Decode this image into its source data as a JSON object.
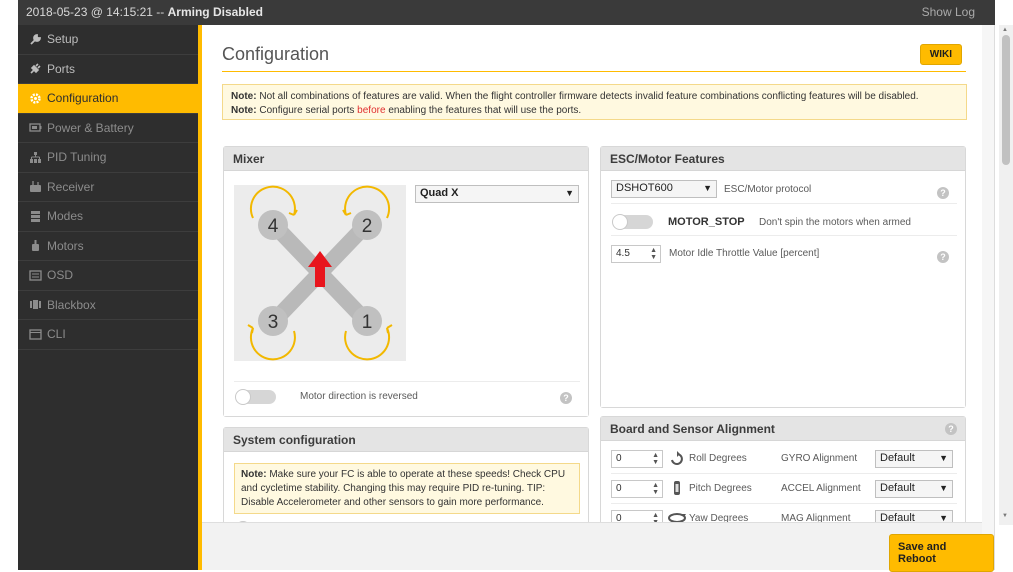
{
  "topbar": {
    "datetime": "2018-05-23 @ 14:15:21 --",
    "status": "Arming Disabled",
    "show_log": "Show Log"
  },
  "sidebar": {
    "items": [
      {
        "label": "Setup",
        "icon": "wrench-icon"
      },
      {
        "label": "Ports",
        "icon": "plug-icon"
      },
      {
        "label": "Configuration",
        "icon": "gear-icon",
        "active": true
      },
      {
        "label": "Power & Battery",
        "icon": "battery-icon"
      },
      {
        "label": "PID Tuning",
        "icon": "pid-icon"
      },
      {
        "label": "Receiver",
        "icon": "receiver-icon"
      },
      {
        "label": "Modes",
        "icon": "modes-icon"
      },
      {
        "label": "Motors",
        "icon": "motor-icon"
      },
      {
        "label": "OSD",
        "icon": "osd-icon"
      },
      {
        "label": "Blackbox",
        "icon": "blackbox-icon"
      },
      {
        "label": "CLI",
        "icon": "cli-icon"
      }
    ]
  },
  "page": {
    "title": "Configuration",
    "wiki": "WIKI",
    "note1_label": "Note:",
    "note1_text": "Not all combinations of features are valid. When the flight controller firmware detects invalid feature combinations conflicting features will be disabled.",
    "note2_label": "Note:",
    "note2_pre": "Configure serial ports",
    "note2_red": "before",
    "note2_post": "enabling the features that will use the ports."
  },
  "mixer": {
    "title": "Mixer",
    "selected": "Quad X",
    "motors": [
      "4",
      "2",
      "3",
      "1"
    ],
    "reversed_label": "Motor direction is reversed",
    "reversed": false
  },
  "esc": {
    "title": "ESC/Motor Features",
    "protocol_value": "DSHOT600",
    "protocol_label": "ESC/Motor protocol",
    "motor_stop_name": "MOTOR_STOP",
    "motor_stop_desc": "Don't spin the motors when armed",
    "idle_value": "4.5",
    "idle_label": "Motor Idle Throttle Value [percent]"
  },
  "system": {
    "title": "System configuration",
    "note_label": "Note:",
    "note_text": "Make sure your FC is able to operate at these speeds! Check CPU and cycletime stability. Changing this may require PID re-tuning. TIP: Disable Accelerometer and other sensors to gain more performance."
  },
  "board": {
    "title": "Board and Sensor Alignment",
    "rows": [
      {
        "value": "0",
        "label": "Roll Degrees",
        "align_label": "GYRO Alignment",
        "align_value": "Default"
      },
      {
        "value": "0",
        "label": "Pitch Degrees",
        "align_label": "ACCEL Alignment",
        "align_value": "Default"
      },
      {
        "value": "0",
        "label": "Yaw Degrees",
        "align_label": "MAG Alignment",
        "align_value": "Default"
      }
    ]
  },
  "footer": {
    "save_label": "Save and Reboot"
  },
  "colors": {
    "accent": "#ffbb00",
    "sidebar": "#2e2e2e",
    "topbar": "#3a3a3a",
    "arrow": "#e8141c",
    "motor_ring": "#f2b800"
  }
}
